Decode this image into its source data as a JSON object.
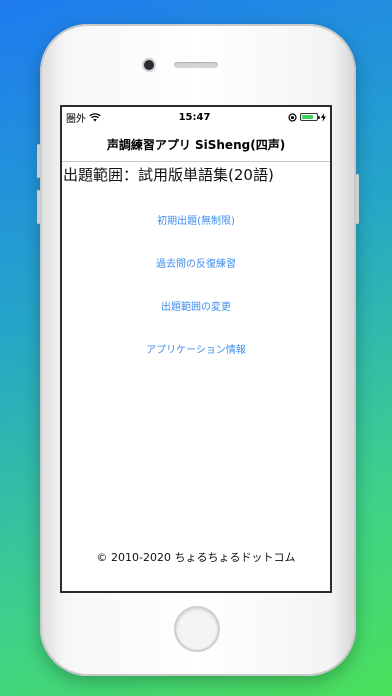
{
  "status_bar": {
    "carrier": "圏外",
    "time": "15:47"
  },
  "nav": {
    "title": "声調練習アプリ SiSheng(四声)"
  },
  "range_label": "出題範囲：試用版単語集(20語)",
  "menu": [
    {
      "label": "初期出題(無制限)"
    },
    {
      "label": "過去問の反復練習"
    },
    {
      "label": "出題範囲の変更"
    },
    {
      "label": "アプリケーション情報"
    }
  ],
  "footer": "© 2010-2020 ちょるちょるドットコム",
  "colors": {
    "accent": "#3d8ef0",
    "battery": "#3bd15a"
  }
}
